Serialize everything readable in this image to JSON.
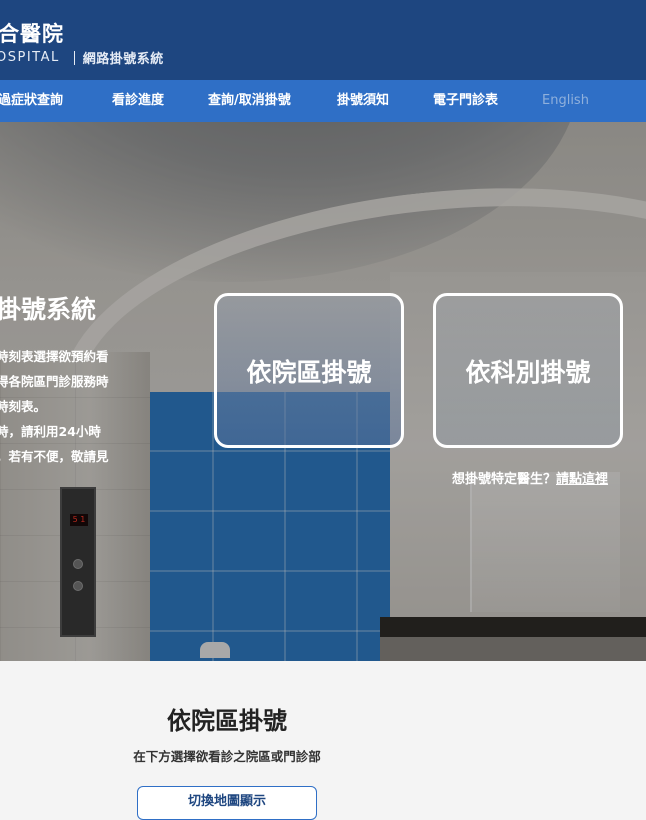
{
  "header": {
    "logo_cn": "合醫院",
    "logo_en": "OSPITAL",
    "system_name": "網路掛號系統"
  },
  "nav": {
    "items": [
      {
        "label": "過症狀查詢"
      },
      {
        "label": "看診進度"
      },
      {
        "label": "查詢/取消掛號"
      },
      {
        "label": "掛號須知"
      },
      {
        "label": "電子門診表"
      },
      {
        "label": "English"
      }
    ]
  },
  "hero": {
    "title": "掛號系統",
    "description_lines": [
      "時刻表選擇欲預約看",
      "得各院區門診服務時",
      "時刻表。",
      "時，請利用24小時",
      "，若有不便，敬請見"
    ],
    "panel_display": "5 1",
    "cards": {
      "by_campus": "依院區掛號",
      "by_department": "依科別掛號"
    },
    "doctor_prompt": "想掛號特定醫生？",
    "doctor_link": "請點這裡"
  },
  "section": {
    "title": "依院區掛號",
    "subtitle": "在下方選擇欲看診之院區或門診部",
    "map_toggle": "切換地圖顯示"
  },
  "colors": {
    "header_bg": "#1e4680",
    "nav_bg": "#2f6fc6"
  }
}
